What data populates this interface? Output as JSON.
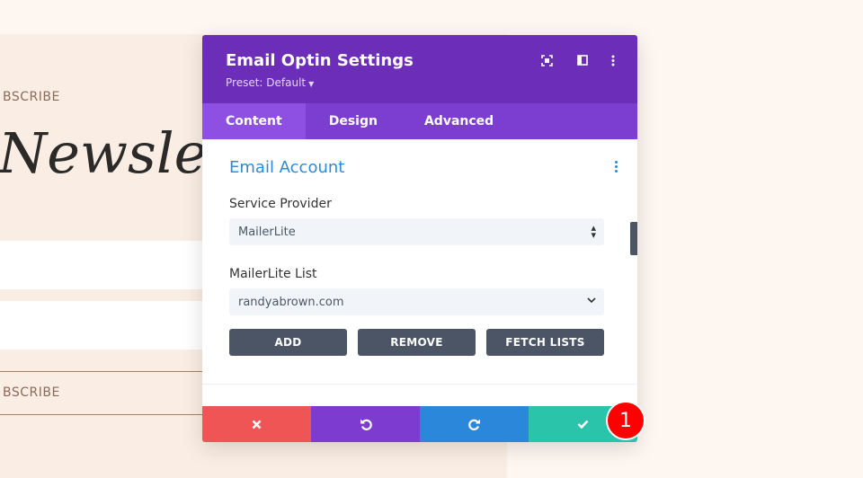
{
  "background": {
    "subscribe_top": "BSCRIBE",
    "title": "Newslett",
    "subscribe_bottom": "BSCRIBE"
  },
  "modal": {
    "title": "Email Optin Settings",
    "preset": "Preset: Default",
    "header_icons": [
      "focus-icon",
      "sidebar-toggle-icon",
      "more-options-icon"
    ],
    "tabs": [
      {
        "label": "Content",
        "active": true
      },
      {
        "label": "Design",
        "active": false
      },
      {
        "label": "Advanced",
        "active": false
      }
    ],
    "section": {
      "title": "Email Account",
      "service_provider": {
        "label": "Service Provider",
        "value": "MailerLite"
      },
      "list": {
        "label": "MailerLite List",
        "value": "randyabrown.com"
      },
      "buttons": {
        "add": "ADD",
        "remove": "REMOVE",
        "fetch": "FETCH LISTS"
      }
    },
    "footer_icons": [
      "close-icon",
      "undo-icon",
      "redo-icon",
      "check-icon"
    ]
  },
  "badge": "1",
  "colors": {
    "header": "#6c2eb9",
    "tabs": "#7b3ed0",
    "active_tab": "#8e4fe3",
    "accent_blue": "#2e89d7",
    "cancel": "#ef5555",
    "undo": "#7e3bd0",
    "redo": "#2b87da",
    "save": "#29c4a9",
    "badge": "#ff0000"
  }
}
